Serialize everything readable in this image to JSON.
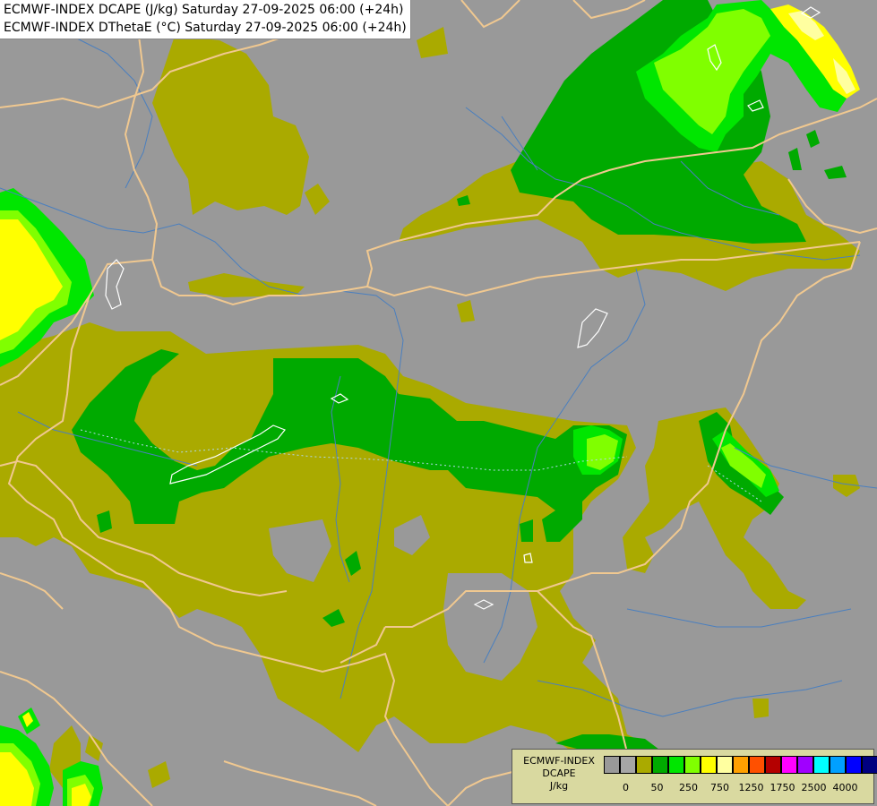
{
  "header": {
    "line1": "ECMWF-INDEX DCAPE (J/kg) Saturday 27-09-2025 06:00 (+24h)",
    "line2": "ECMWF-INDEX DThetaE (°C) Saturday 27-09-2025 06:00 (+24h)"
  },
  "legend": {
    "model": "ECMWF-INDEX",
    "parameter": "DCAPE",
    "unit": "J/kg",
    "colors": [
      "#999999",
      "#a6a6a6",
      "#aaaa00",
      "#00aa00",
      "#00e600",
      "#80ff00",
      "#ffff00",
      "#ffffa0",
      "#ffa000",
      "#ff5000",
      "#b40000",
      "#ff00ff",
      "#a000ff",
      "#00ffff",
      "#00a0ff",
      "#0000ff",
      "#000080"
    ],
    "tick_labels": [
      "0",
      "50",
      "250",
      "750",
      "1250",
      "1750",
      "2500",
      "4000"
    ]
  },
  "palette": {
    "background": "#999999",
    "olive": "#aaaa00",
    "green_dark": "#00aa00",
    "green_mid": "#00e600",
    "green_light": "#80ff00",
    "yellow": "#ffff00",
    "pale_yellow": "#ffffa0",
    "border": "#f0c890",
    "river": "#4a7fbf"
  }
}
